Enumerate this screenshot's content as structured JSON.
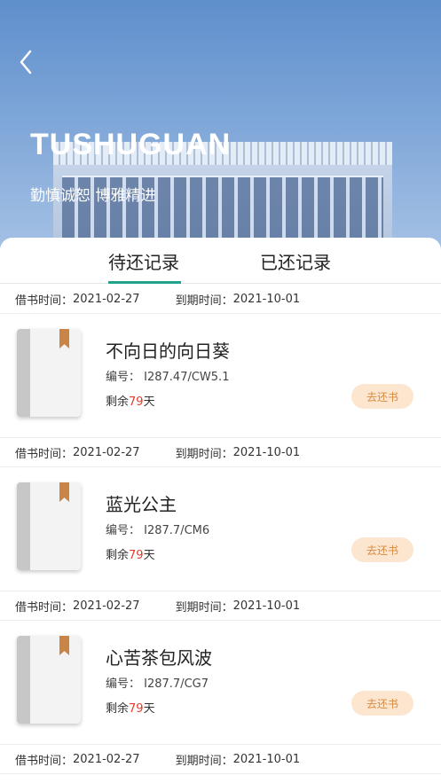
{
  "header": {
    "title": "TUSHUGUAN",
    "subtitle": "勤慎诚恕 博雅精进"
  },
  "tabs": [
    {
      "label": "待还记录",
      "active": true
    },
    {
      "label": "已还记录",
      "active": false
    }
  ],
  "labels": {
    "borrow_time": "借书时间：",
    "due_time": "到期时间：",
    "code": "编号：",
    "remain_prefix": "剩余",
    "remain_suffix": "天",
    "return_button": "去还书"
  },
  "records": [
    {
      "borrow_date": "2021-02-27",
      "due_date": "2021-10-01",
      "title": "不向日的向日葵",
      "code": "I287.47/CW5.1",
      "remain_days": "79"
    },
    {
      "borrow_date": "2021-02-27",
      "due_date": "2021-10-01",
      "title": "蓝光公主",
      "code": "I287.7/CM6",
      "remain_days": "79"
    },
    {
      "borrow_date": "2021-02-27",
      "due_date": "2021-10-01",
      "title": "心苦茶包风波",
      "code": "I287.7/CG7",
      "remain_days": "79"
    }
  ],
  "last_dates": {
    "borrow_date": "2021-02-27",
    "due_date": "2021-10-01"
  },
  "colors": {
    "accent": "#21a38b",
    "remain_number": "#e33b2b",
    "return_button_bg": "#fde6cf",
    "return_button_text": "#d98a3e"
  },
  "icons": {
    "back": "chevron-left-icon",
    "book": "book-cover-icon"
  }
}
